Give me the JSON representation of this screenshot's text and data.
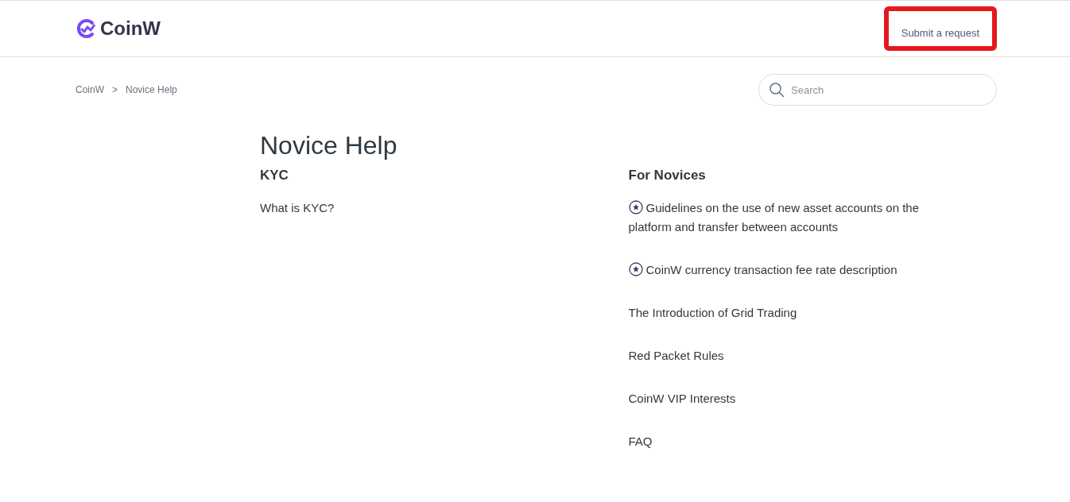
{
  "header": {
    "logo": "CoinW",
    "submit_link": "Submit a request",
    "submit_highlighted": true
  },
  "breadcrumbs": [
    {
      "label": "CoinW"
    },
    {
      "label": "Novice Help"
    }
  ],
  "breadcrumb_separator": ">",
  "search": {
    "placeholder": "Search"
  },
  "page_title": "Novice Help",
  "sections": [
    {
      "title": "KYC",
      "articles": [
        {
          "title": "What is KYC?",
          "promoted": false
        }
      ]
    },
    {
      "title": "For Novices",
      "articles": [
        {
          "title": "Guidelines on the use of new asset accounts on the platform and transfer between accounts",
          "promoted": true
        },
        {
          "title": "CoinW currency transaction fee rate description",
          "promoted": true
        },
        {
          "title": "The Introduction of Grid Trading",
          "promoted": false
        },
        {
          "title": "Red Packet Rules",
          "promoted": false
        },
        {
          "title": "CoinW VIP Interests",
          "promoted": false
        },
        {
          "title": "FAQ",
          "promoted": false
        }
      ]
    }
  ]
}
